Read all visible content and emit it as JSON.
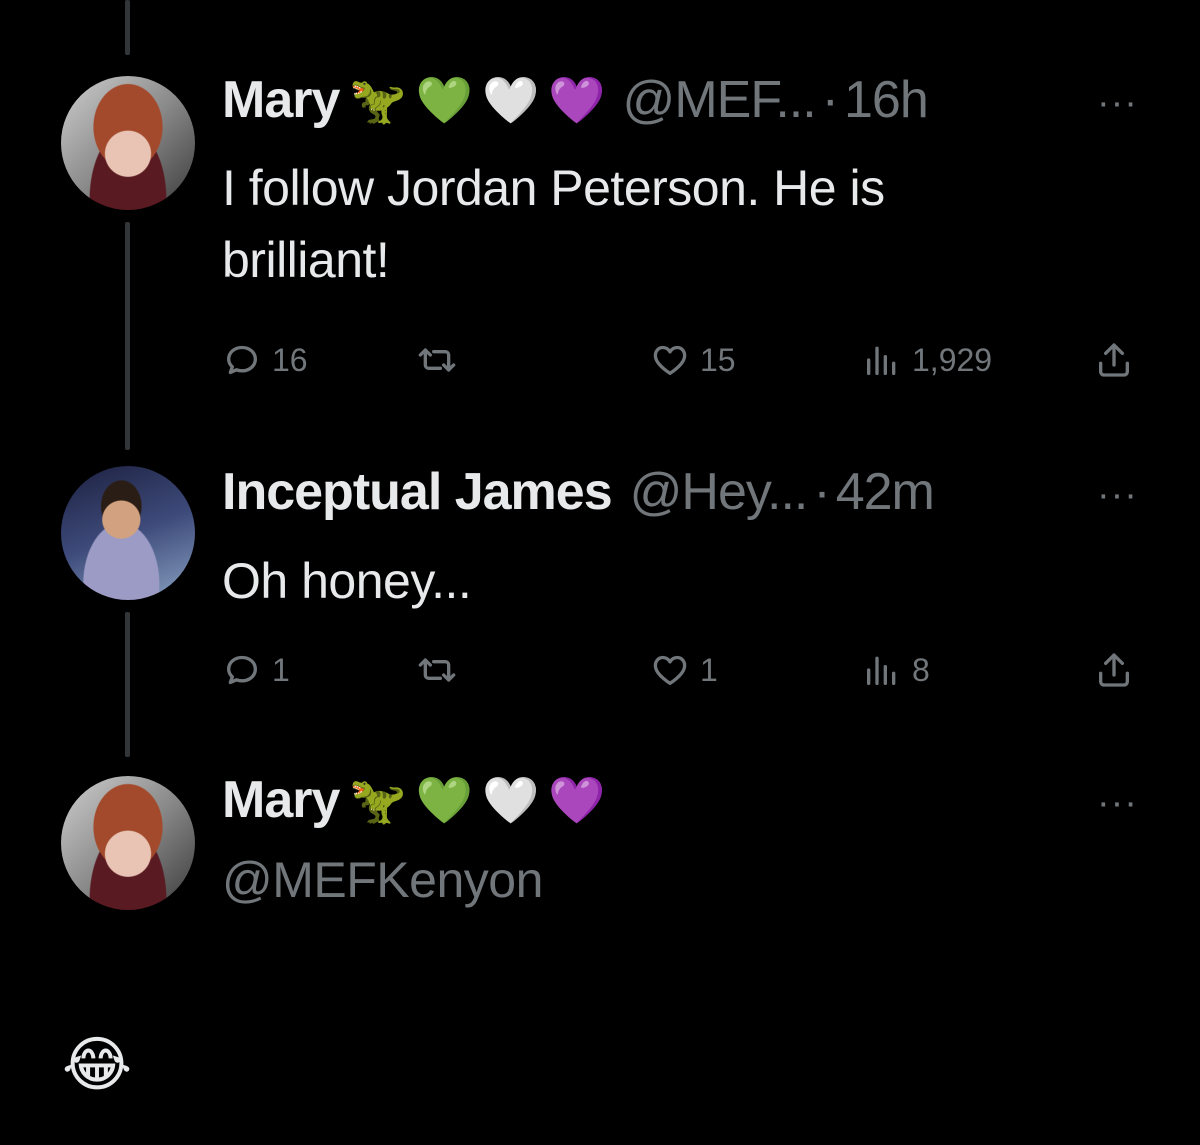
{
  "posts": [
    {
      "name": "Mary",
      "emojis": [
        "🦖",
        "💚",
        "🤍",
        "💜"
      ],
      "handle": "@MEF...",
      "time": "16h",
      "separator": "·",
      "more": "···",
      "text_lines": [
        "I follow Jordan Peterson. He is",
        "brilliant!"
      ],
      "replies": "16",
      "retweets": "",
      "likes": "15",
      "views": "1,929"
    },
    {
      "name": "Inceptual James",
      "handle": "@Hey...",
      "time": "42m",
      "separator": "·",
      "more": "···",
      "text_lines": [
        "Oh honey..."
      ],
      "replies": "1",
      "retweets": "",
      "likes": "1",
      "views": "8"
    },
    {
      "name": "Mary",
      "emojis": [
        "🦖",
        "💚",
        "🤍",
        "💜"
      ],
      "handle": "@MEFKenyon",
      "more": "···"
    }
  ],
  "reaction_emoji": "😂",
  "icons": [
    "reply-icon",
    "retweet-icon",
    "like-icon",
    "views-icon",
    "share-icon",
    "more-icon"
  ]
}
